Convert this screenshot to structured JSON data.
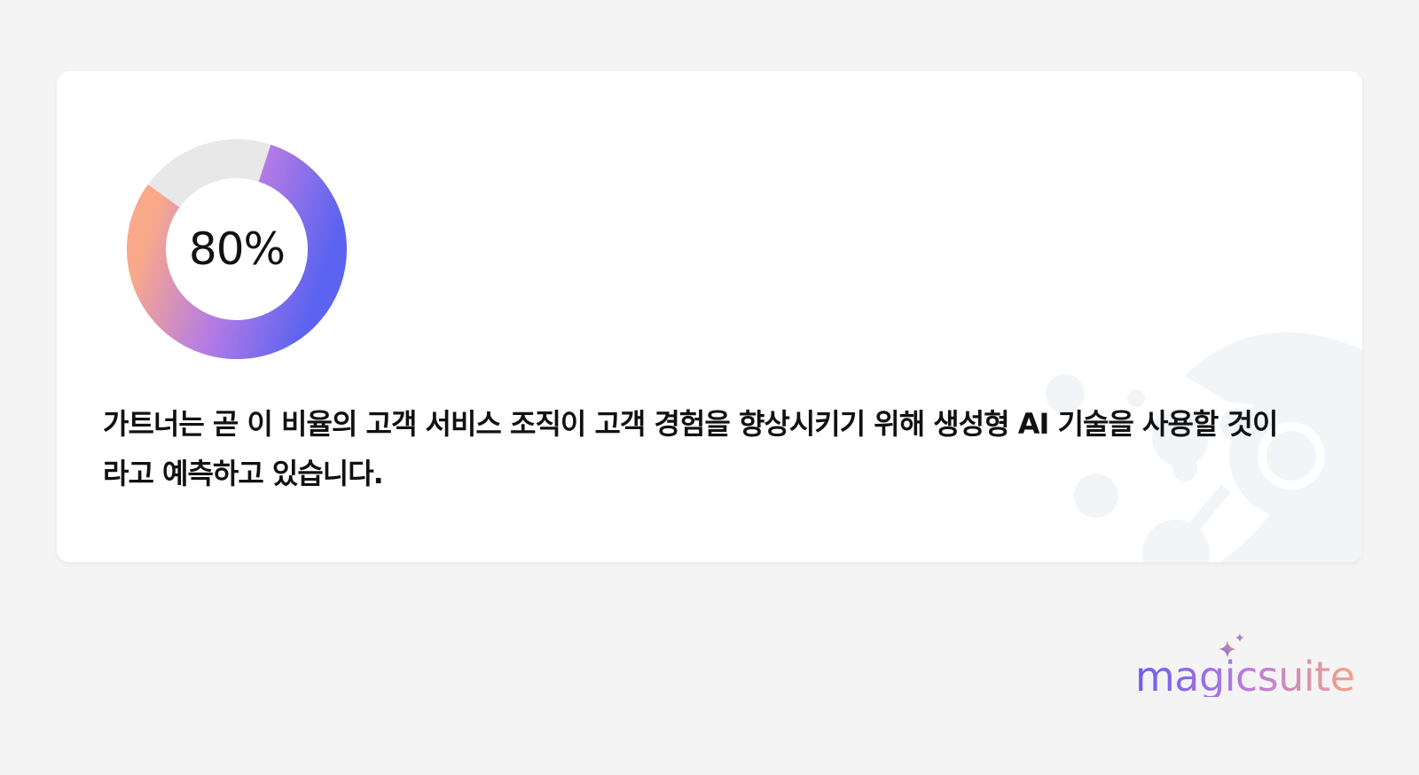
{
  "stat": {
    "value": 80,
    "label": "80%"
  },
  "statement": "가트너는 곧 이 비율의 고객 서비스 조직이 고객 경험을 향상시키기 위해 생성형 AI 기술을 사용할 것이라고 예측하고 있습니다.",
  "brand": {
    "name": "magicsuite",
    "icon": "sparkle-icon"
  },
  "colors": {
    "background": "#f4f4f4",
    "card": "#ffffff",
    "track": "#e8e8e8",
    "gradient_start": "#f9a98a",
    "gradient_mid": "#b57be5",
    "gradient_end": "#5b63f0",
    "text": "#111111"
  }
}
